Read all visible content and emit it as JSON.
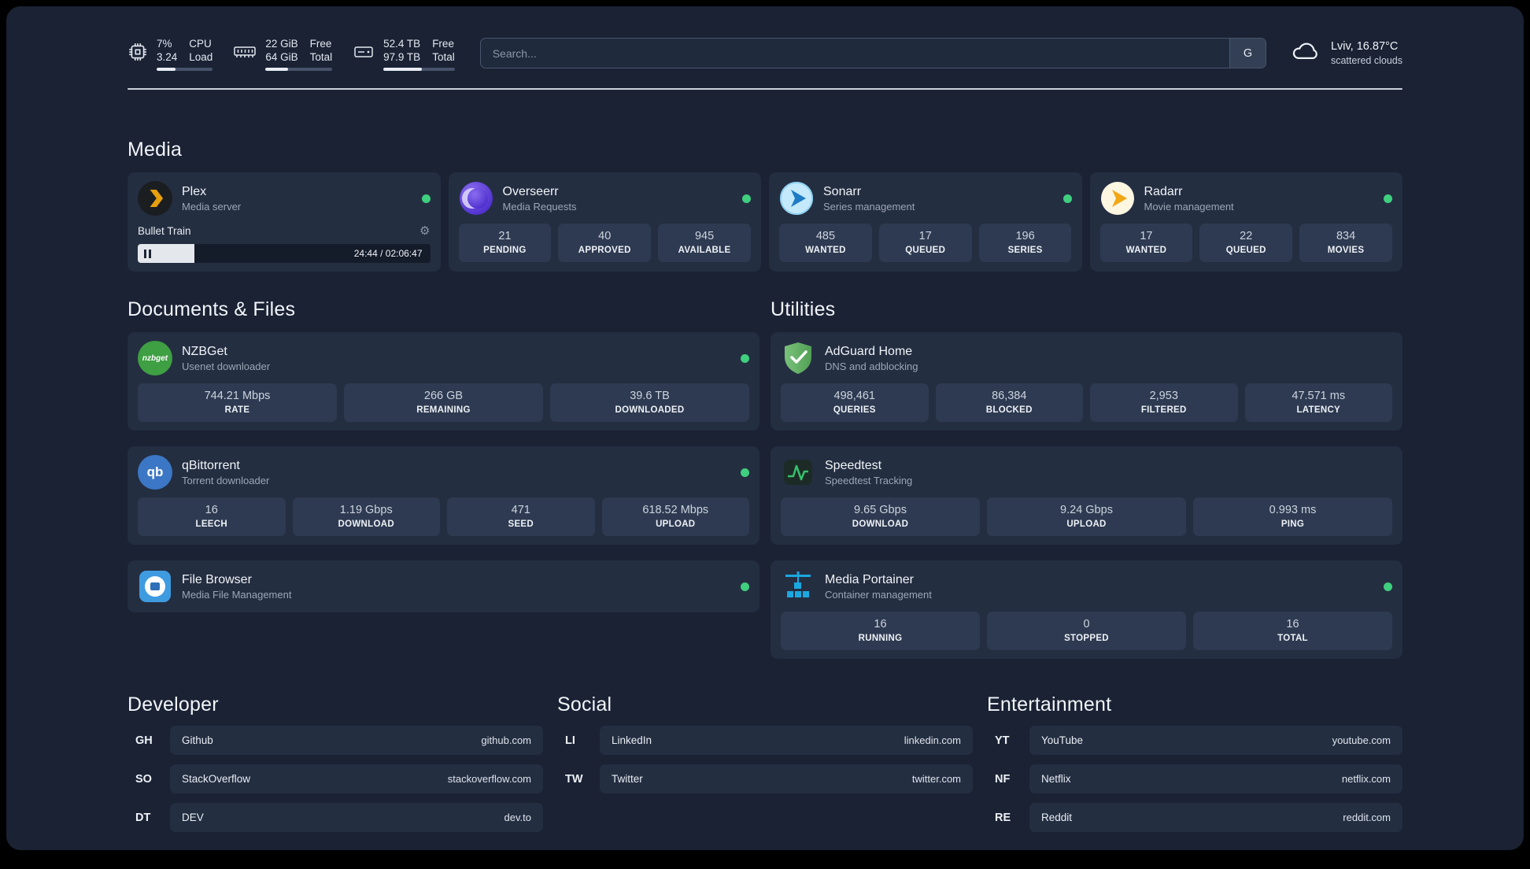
{
  "icons": {
    "gear": "⚙"
  },
  "colors": {
    "status_online": "#3fcf7f",
    "plex_accent": "#e5a00d"
  },
  "header": {
    "cpu": {
      "value_top": "7%",
      "value_bottom": "3.24",
      "label_top": "CPU",
      "label_bottom": "Load",
      "bar_percent": 33
    },
    "ram": {
      "value_top": "22 GiB",
      "value_bottom": "64 GiB",
      "label_top": "Free",
      "label_bottom": "Total",
      "bar_percent": 34
    },
    "disk": {
      "value_top": "52.4 TB",
      "value_bottom": "97.9 TB",
      "label_top": "Free",
      "label_bottom": "Total",
      "bar_percent": 54
    },
    "search": {
      "placeholder": "Search...",
      "engine_label": "G"
    },
    "weather": {
      "location": "Lviv, 16.87°C",
      "condition": "scattered clouds"
    }
  },
  "media": {
    "section_title": "Media",
    "plex": {
      "name": "Plex",
      "desc": "Media server",
      "now_playing": "Bullet Train",
      "progress_percent": 19.5,
      "time": "24:44 / 02:06:47"
    },
    "overseerr": {
      "name": "Overseerr",
      "desc": "Media Requests",
      "stats": [
        {
          "value": "21",
          "label": "PENDING"
        },
        {
          "value": "40",
          "label": "APPROVED"
        },
        {
          "value": "945",
          "label": "AVAILABLE"
        }
      ]
    },
    "sonarr": {
      "name": "Sonarr",
      "desc": "Series management",
      "stats": [
        {
          "value": "485",
          "label": "WANTED"
        },
        {
          "value": "17",
          "label": "QUEUED"
        },
        {
          "value": "196",
          "label": "SERIES"
        }
      ]
    },
    "radarr": {
      "name": "Radarr",
      "desc": "Movie management",
      "stats": [
        {
          "value": "17",
          "label": "WANTED"
        },
        {
          "value": "22",
          "label": "QUEUED"
        },
        {
          "value": "834",
          "label": "MOVIES"
        }
      ]
    }
  },
  "documents": {
    "section_title": "Documents & Files",
    "nzbget": {
      "name": "NZBGet",
      "desc": "Usenet downloader",
      "stats": [
        {
          "value": "744.21 Mbps",
          "label": "RATE"
        },
        {
          "value": "266 GB",
          "label": "REMAINING"
        },
        {
          "value": "39.6 TB",
          "label": "DOWNLOADED"
        }
      ]
    },
    "qbittorrent": {
      "name": "qBittorrent",
      "desc": "Torrent downloader",
      "stats": [
        {
          "value": "16",
          "label": "LEECH"
        },
        {
          "value": "1.19 Gbps",
          "label": "DOWNLOAD"
        },
        {
          "value": "471",
          "label": "SEED"
        },
        {
          "value": "618.52 Mbps",
          "label": "UPLOAD"
        }
      ]
    },
    "filebrowser": {
      "name": "File Browser",
      "desc": "Media File Management"
    }
  },
  "utilities": {
    "section_title": "Utilities",
    "adguard": {
      "name": "AdGuard Home",
      "desc": "DNS and adblocking",
      "stats": [
        {
          "value": "498,461",
          "label": "QUERIES"
        },
        {
          "value": "86,384",
          "label": "BLOCKED"
        },
        {
          "value": "2,953",
          "label": "FILTERED"
        },
        {
          "value": "47.571 ms",
          "label": "LATENCY"
        }
      ]
    },
    "speedtest": {
      "name": "Speedtest",
      "desc": "Speedtest Tracking",
      "stats": [
        {
          "value": "9.65 Gbps",
          "label": "DOWNLOAD"
        },
        {
          "value": "9.24 Gbps",
          "label": "UPLOAD"
        },
        {
          "value": "0.993 ms",
          "label": "PING"
        }
      ]
    },
    "portainer": {
      "name": "Media Portainer",
      "desc": "Container management",
      "stats": [
        {
          "value": "16",
          "label": "RUNNING"
        },
        {
          "value": "0",
          "label": "STOPPED"
        },
        {
          "value": "16",
          "label": "TOTAL"
        }
      ]
    }
  },
  "bookmarks": {
    "developer": {
      "section_title": "Developer",
      "items": [
        {
          "abbr": "GH",
          "name": "Github",
          "url": "github.com"
        },
        {
          "abbr": "SO",
          "name": "StackOverflow",
          "url": "stackoverflow.com"
        },
        {
          "abbr": "DT",
          "name": "DEV",
          "url": "dev.to"
        }
      ]
    },
    "social": {
      "section_title": "Social",
      "items": [
        {
          "abbr": "LI",
          "name": "LinkedIn",
          "url": "linkedin.com"
        },
        {
          "abbr": "TW",
          "name": "Twitter",
          "url": "twitter.com"
        }
      ]
    },
    "entertainment": {
      "section_title": "Entertainment",
      "items": [
        {
          "abbr": "YT",
          "name": "YouTube",
          "url": "youtube.com"
        },
        {
          "abbr": "NF",
          "name": "Netflix",
          "url": "netflix.com"
        },
        {
          "abbr": "RE",
          "name": "Reddit",
          "url": "reddit.com"
        }
      ]
    }
  }
}
